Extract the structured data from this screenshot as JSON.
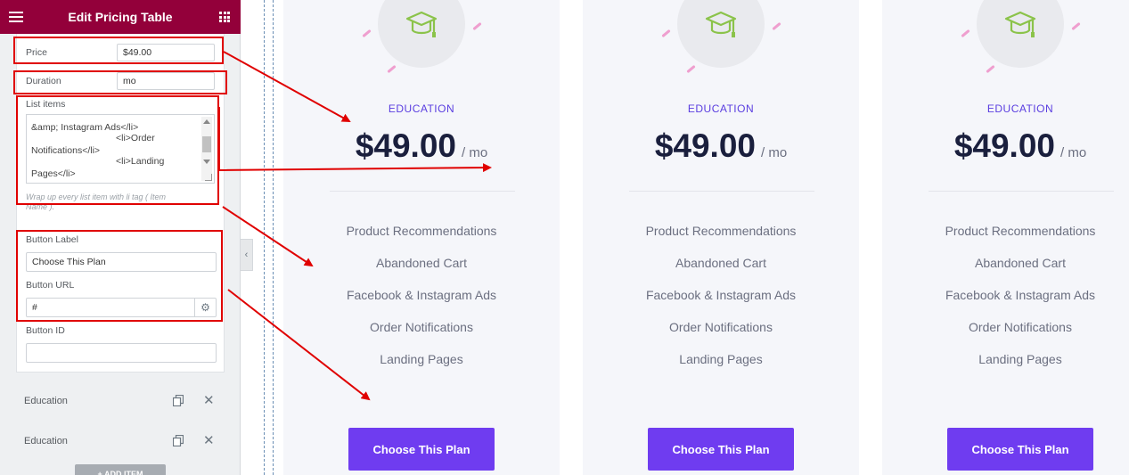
{
  "editor": {
    "title": "Edit Pricing Table",
    "menu_icon": "hamburger-icon",
    "apps_icon": "grid-icon"
  },
  "form": {
    "price_label": "Price",
    "price_value": "$49.00",
    "duration_label": "Duration",
    "duration_value": "mo",
    "list_label": "List items",
    "list_lines": [
      "&amp; Instagram Ads</li>",
      "<li>Order",
      "Notifications</li>",
      "<li>Landing",
      "Pages</li>"
    ],
    "list_hint": "Wrap up every list item with li tag ( Item Name ).",
    "button_label_label": "Button Label",
    "button_label_value": "Choose This Plan",
    "button_url_label": "Button URL",
    "button_url_value": "#",
    "button_id_label": "Button ID",
    "button_id_value": ""
  },
  "repeater_items": [
    {
      "label": "Education"
    },
    {
      "label": "Education"
    }
  ],
  "add_item_label": "+ ADD ITEM",
  "cards": [
    {
      "title": "EDUCATION",
      "price": "$49.00",
      "duration": "/ mo",
      "features": [
        "Product Recommendations",
        "Abandoned Cart",
        "Facebook & Instagram Ads",
        "Order Notifications",
        "Landing Pages"
      ],
      "button": "Choose This Plan"
    },
    {
      "title": "EDUCATION",
      "price": "$49.00",
      "duration": "/ mo",
      "features": [
        "Product Recommendations",
        "Abandoned Cart",
        "Facebook & Instagram Ads",
        "Order Notifications",
        "Landing Pages"
      ],
      "button": "Choose This Plan"
    },
    {
      "title": "EDUCATION",
      "price": "$49.00",
      "duration": "/ mo",
      "features": [
        "Product Recommendations",
        "Abandoned Cart",
        "Facebook & Instagram Ads",
        "Order Notifications",
        "Landing Pages"
      ],
      "button": "Choose This Plan"
    }
  ],
  "colors": {
    "editor_header": "#93003a",
    "accent": "#6f3cf0",
    "plan_title": "#5a3ee0",
    "annotation": "#e00000",
    "icon": "#8bc34a"
  }
}
